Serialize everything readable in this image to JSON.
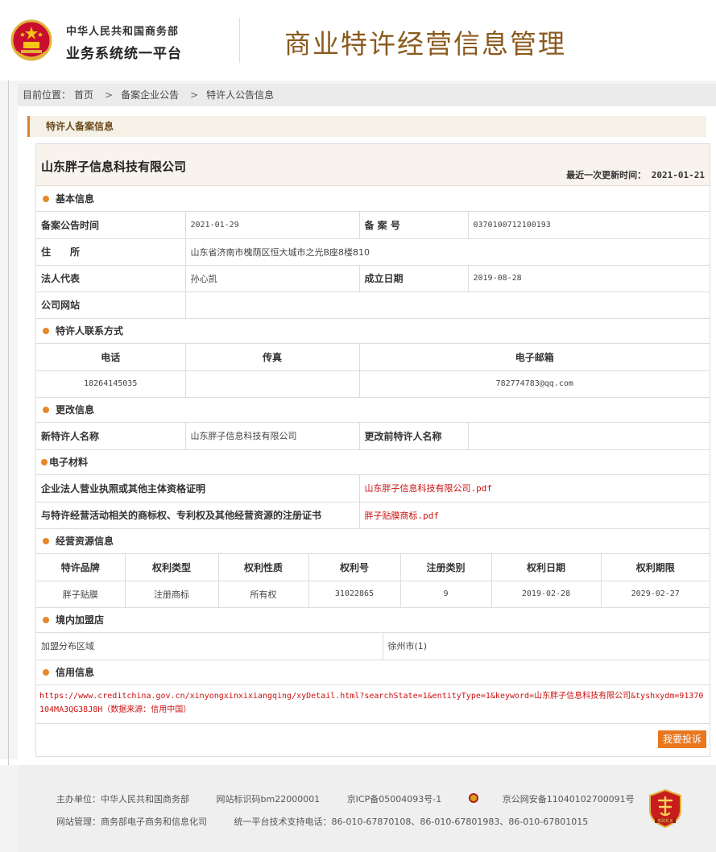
{
  "header": {
    "gov_line1": "中华人民共和国商务部",
    "gov_line2": "业务系统统一平台",
    "system_title": "商业特许经营信息管理"
  },
  "breadcrumb": {
    "prefix": "目前位置：",
    "items": [
      "首页",
      "备案企业公告",
      "特许人公告信息"
    ],
    "separator": ">"
  },
  "panel": {
    "title": "特许人备案信息"
  },
  "company": {
    "name": "山东胖子信息科技有限公司",
    "update_label": "最近一次更新时间：",
    "update_value": "2021-01-21"
  },
  "basic": {
    "section_title": "基本信息",
    "announce_time_label": "备案公告时间",
    "announce_time_value": "2021-01-29",
    "record_no_label": "备 案 号",
    "record_no_value": "0370100712100193",
    "address_label": "住　　所",
    "address_value": "山东省济南市槐荫区恒大城市之光B座8楼810",
    "legal_rep_label": "法人代表",
    "legal_rep_value": "孙心凯",
    "founded_label": "成立日期",
    "founded_value": "2019-08-28",
    "website_label": "公司网站",
    "website_value": ""
  },
  "contact": {
    "section_title": "特许人联系方式",
    "headers": [
      "电话",
      "传真",
      "电子邮箱"
    ],
    "phone": "18264145035",
    "fax": "",
    "email": "782774783@qq.com"
  },
  "change": {
    "section_title": "更改信息",
    "new_name_label": "新特许人名称",
    "new_name_value": "山东胖子信息科技有限公司",
    "old_name_label": "更改前特许人名称",
    "old_name_value": ""
  },
  "materials": {
    "section_title": "电子材料",
    "rows": [
      {
        "label": "企业法人营业执照或其他主体资格证明",
        "file": "山东胖子信息科技有限公司.pdf"
      },
      {
        "label": "与特许经营活动相关的商标权、专利权及其他经营资源的注册证书",
        "file": "胖子贴膜商标.pdf"
      }
    ]
  },
  "resources": {
    "section_title": "经营资源信息",
    "headers": [
      "特许品牌",
      "权利类型",
      "权利性质",
      "权利号",
      "注册类别",
      "权利日期",
      "权利期限"
    ],
    "row": [
      "胖子贴膜",
      "注册商标",
      "所有权",
      "31022865",
      "9",
      "2019-02-28",
      "2029-02-27"
    ]
  },
  "stores": {
    "section_title": "境内加盟店",
    "region_label": "加盟分布区域",
    "region_value": "徐州市(1)"
  },
  "credit": {
    "section_title": "信用信息",
    "link_text": "https://www.creditchina.gov.cn/xinyongxinxixiangqing/xyDetail.html?searchState=1&entityType=1&keyword=山东胖子信息科技有限公司&tyshxydm=91370104MA3QG38J8H（数据来源：信用中国）",
    "complain_label": "我要投诉"
  },
  "footer": {
    "host": "主办单位：中华人民共和国商务部",
    "site_id": "网站标识码bm22000001",
    "icp": "京ICP备05004093号-1",
    "police": "京公网安备11040102700091号",
    "manager": "网站管理：商务部电子商务和信息化司",
    "support": "统一平台技术支持电话：86-010-67870108、86-010-67801983、86-010-67801015",
    "badge_text": "党政机关"
  },
  "colors": {
    "accent": "#e8862a",
    "title_brown": "#8a5a1e",
    "link_red": "#cc1111"
  }
}
